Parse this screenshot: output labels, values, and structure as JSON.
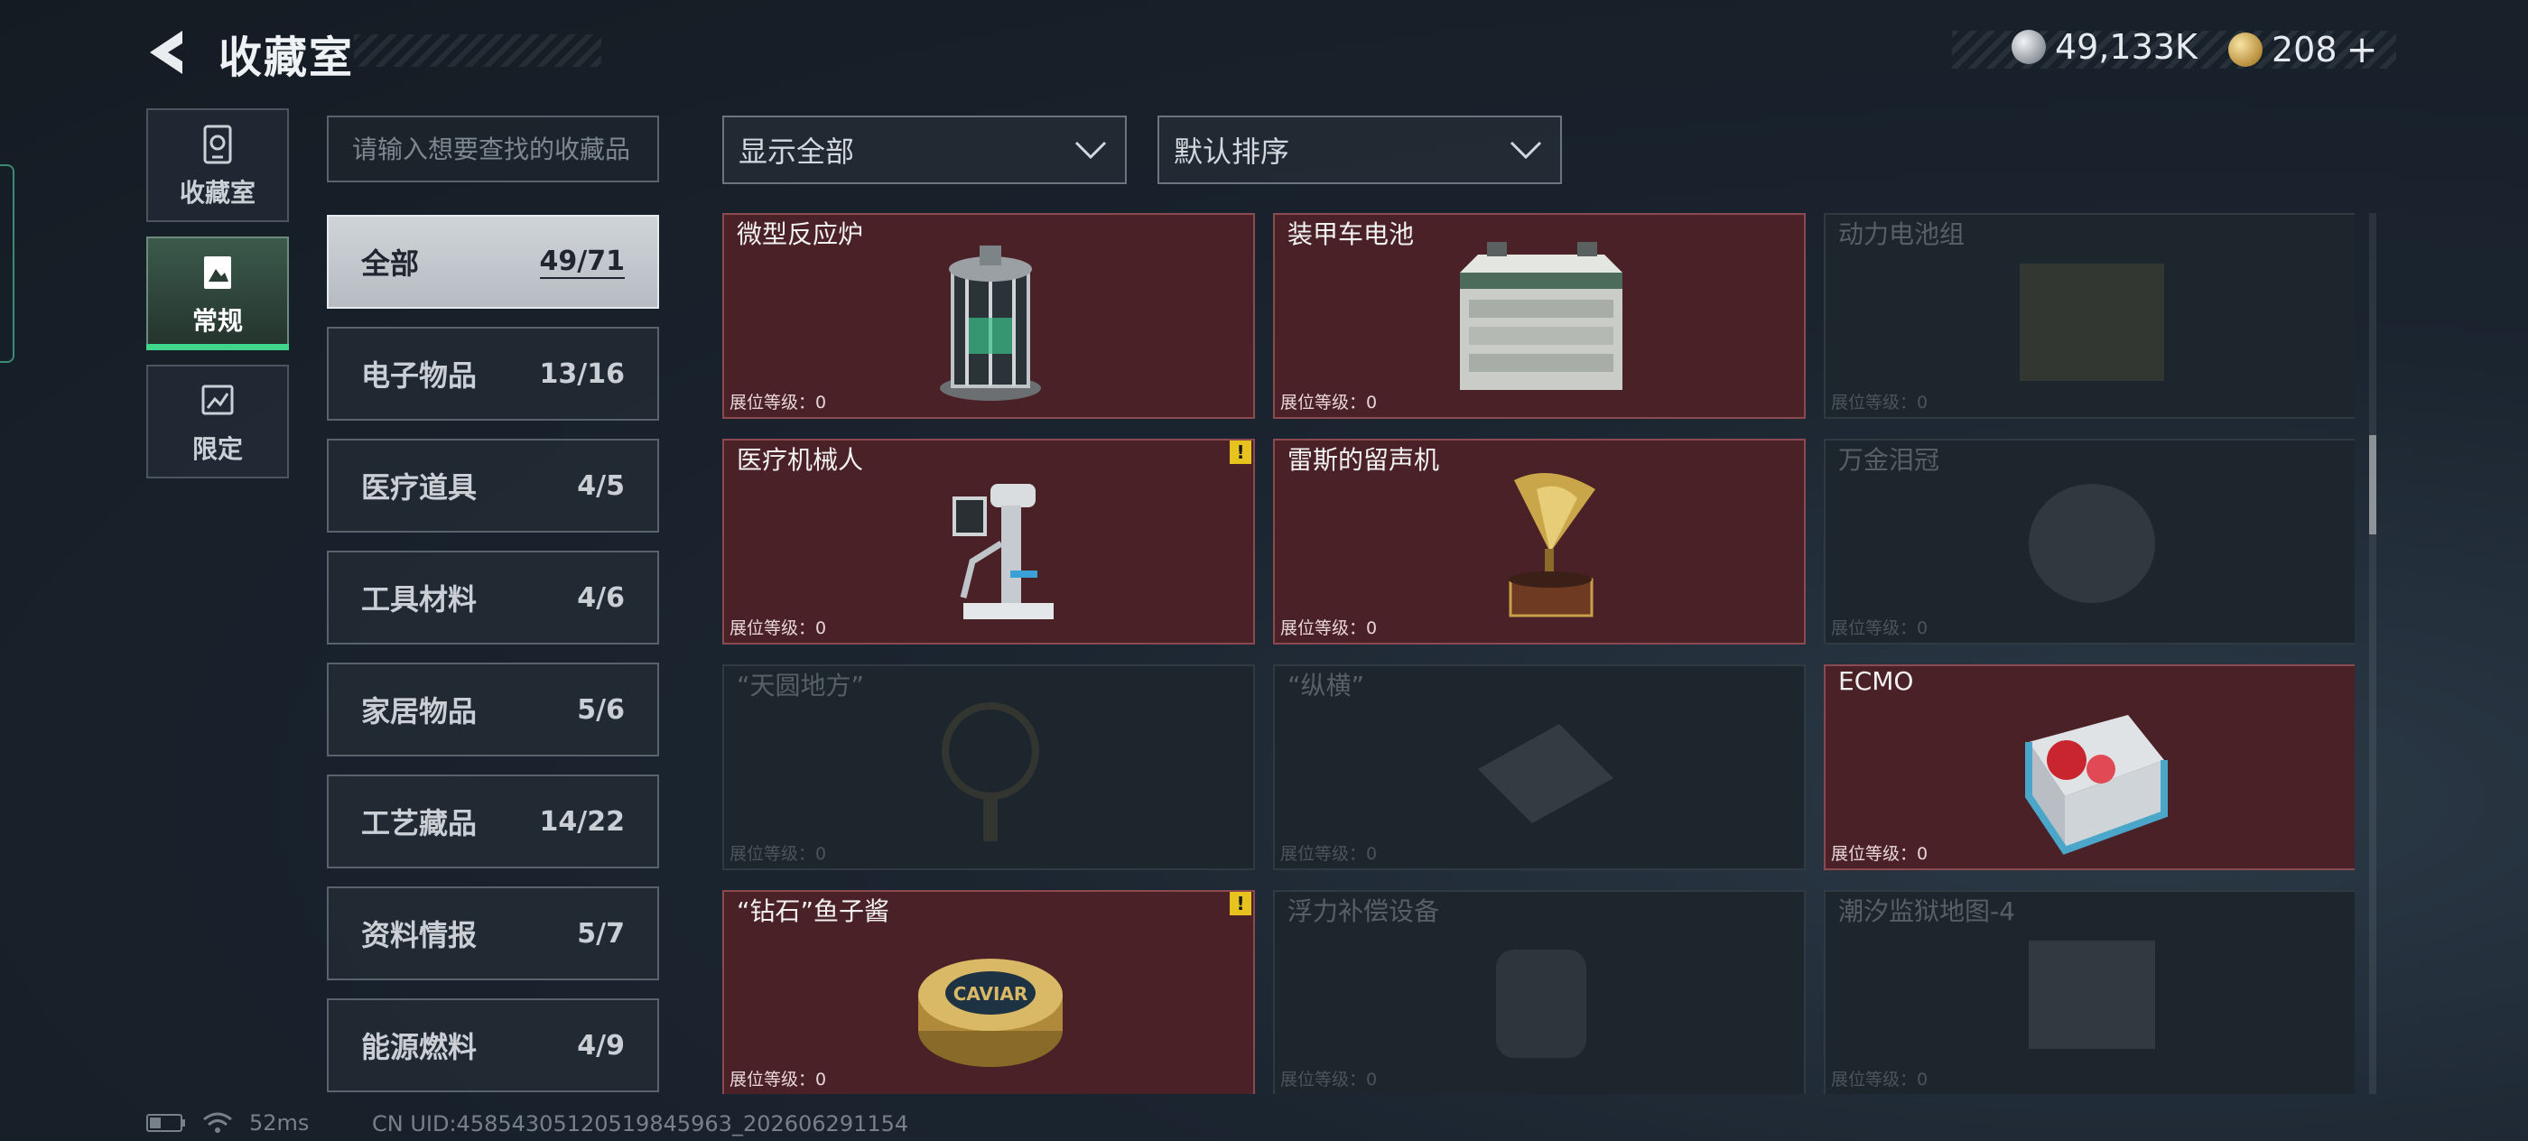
{
  "header": {
    "title": "收藏室"
  },
  "currency": [
    {
      "name": "silver-coin-icon",
      "value": "49,133K"
    },
    {
      "name": "gold-coin-icon",
      "value": "208",
      "plus": "+"
    }
  ],
  "nav": [
    {
      "label": "收藏室",
      "icon": "vault-icon"
    },
    {
      "label": "常规",
      "icon": "album-icon",
      "active": true
    },
    {
      "label": "限定",
      "icon": "limited-icon"
    }
  ],
  "search": {
    "placeholder": "请输入想要查找的收藏品"
  },
  "categories": [
    {
      "name": "全部",
      "count": "49/71",
      "active": true
    },
    {
      "name": "电子物品",
      "count": "13/16"
    },
    {
      "name": "医疗道具",
      "count": "4/5"
    },
    {
      "name": "工具材料",
      "count": "4/6"
    },
    {
      "name": "家居物品",
      "count": "5/6"
    },
    {
      "name": "工艺藏品",
      "count": "14/22"
    },
    {
      "name": "资料情报",
      "count": "5/7"
    },
    {
      "name": "能源燃料",
      "count": "4/9"
    }
  ],
  "filters": {
    "display": "显示全部",
    "sort": "默认排序"
  },
  "items": [
    {
      "name": "微型反应炉",
      "level": "展位等级：0",
      "owned": true,
      "icon": "reactor-icon"
    },
    {
      "name": "装甲车电池",
      "level": "展位等级：0",
      "owned": true,
      "icon": "battery-icon"
    },
    {
      "name": "动力电池组",
      "level": "展位等级：0",
      "owned": false,
      "icon": "battery-pack-icon"
    },
    {
      "name": "医疗机械人",
      "level": "展位等级：0",
      "owned": true,
      "warning": "!",
      "icon": "medical-robot-icon"
    },
    {
      "name": "雷斯的留声机",
      "level": "展位等级：0",
      "owned": true,
      "icon": "gramophone-icon"
    },
    {
      "name": "万金泪冠",
      "level": "展位等级：0",
      "owned": false,
      "icon": "crown-icon"
    },
    {
      "name": "“天圆地方”",
      "level": "展位等级：0",
      "owned": false,
      "icon": "astrolabe-icon"
    },
    {
      "name": "“纵横”",
      "level": "展位等级：0",
      "owned": false,
      "icon": "chessboard-icon"
    },
    {
      "name": "ECMO",
      "level": "展位等级：0",
      "owned": true,
      "icon": "ecmo-icon"
    },
    {
      "name": "“钻石”鱼子酱",
      "level": "展位等级：0",
      "owned": true,
      "warning": "!",
      "icon": "caviar-tin-icon",
      "label": "CAVIAR"
    },
    {
      "name": "浮力补偿设备",
      "level": "展位等级：0",
      "owned": false,
      "icon": "buoyancy-device-icon"
    },
    {
      "name": "潮汐监狱地图-4",
      "level": "展位等级：0",
      "owned": false,
      "icon": "map-icon"
    }
  ],
  "status": {
    "ping": "52ms",
    "uid": "CN UID:4585430512051984596​3_202606291154"
  }
}
